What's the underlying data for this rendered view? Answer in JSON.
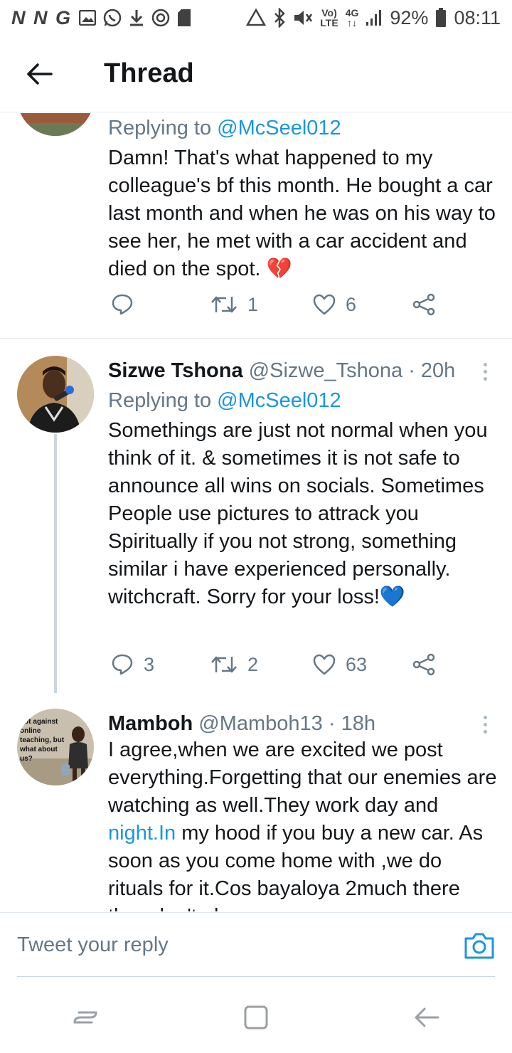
{
  "status_bar": {
    "left_text": "N N G",
    "data_label_top": "Vo)",
    "data_label_bottom": "LTE",
    "network_top": "4G",
    "network_bottom": "↑↓",
    "battery_percent": "92%",
    "time": "08:11"
  },
  "header": {
    "title": "Thread"
  },
  "tweets": [
    {
      "replying_prefix": "Replying to ",
      "replying_handle": "@McSeel012",
      "text": "Damn! That's what happened to my colleague's bf this month. He bought a car last month and when he was on his way to see her, he met with a car accident and died on the spot. 💔",
      "retweets": "1",
      "likes": "6",
      "avatar_icon": "building-photo"
    },
    {
      "name": "Sizwe Tshona",
      "handle": "@Sizwe_Tshona",
      "time": "· 20h",
      "replying_prefix": "Replying to ",
      "replying_handle": "@McSeel012",
      "text": "Somethings are just not normal when you think of it. & sometimes it is not safe to announce all wins on socials. Sometimes People use pictures to attrack you Spiritually if you not strong, something similar i have experienced personally. witchcraft. Sorry for your loss!💙",
      "replies": "3",
      "retweets": "2",
      "likes": "63",
      "avatar_icon": "man-microphone-photo"
    },
    {
      "name": "Mamboh",
      "handle": "@Mamboh13",
      "time": "· 18h",
      "text_before_link": "I agree,when we are excited we post everything.Forgetting that our enemies are watching as well.They work day and ",
      "link": "night.In",
      "text_after_link": " my hood if you buy a new car. As soon as you come home with ,we do rituals for it.Cos bayaloya 2much there they don't play",
      "avatar_text": "not against online teaching, but what about us?",
      "avatar_icon": "meme-child-photo"
    }
  ],
  "reply_bar": {
    "placeholder": "Tweet your reply"
  },
  "colors": {
    "accent": "#1b95e0",
    "text": "#14171a",
    "secondary": "#657786",
    "divider": "#e1e8ed"
  }
}
